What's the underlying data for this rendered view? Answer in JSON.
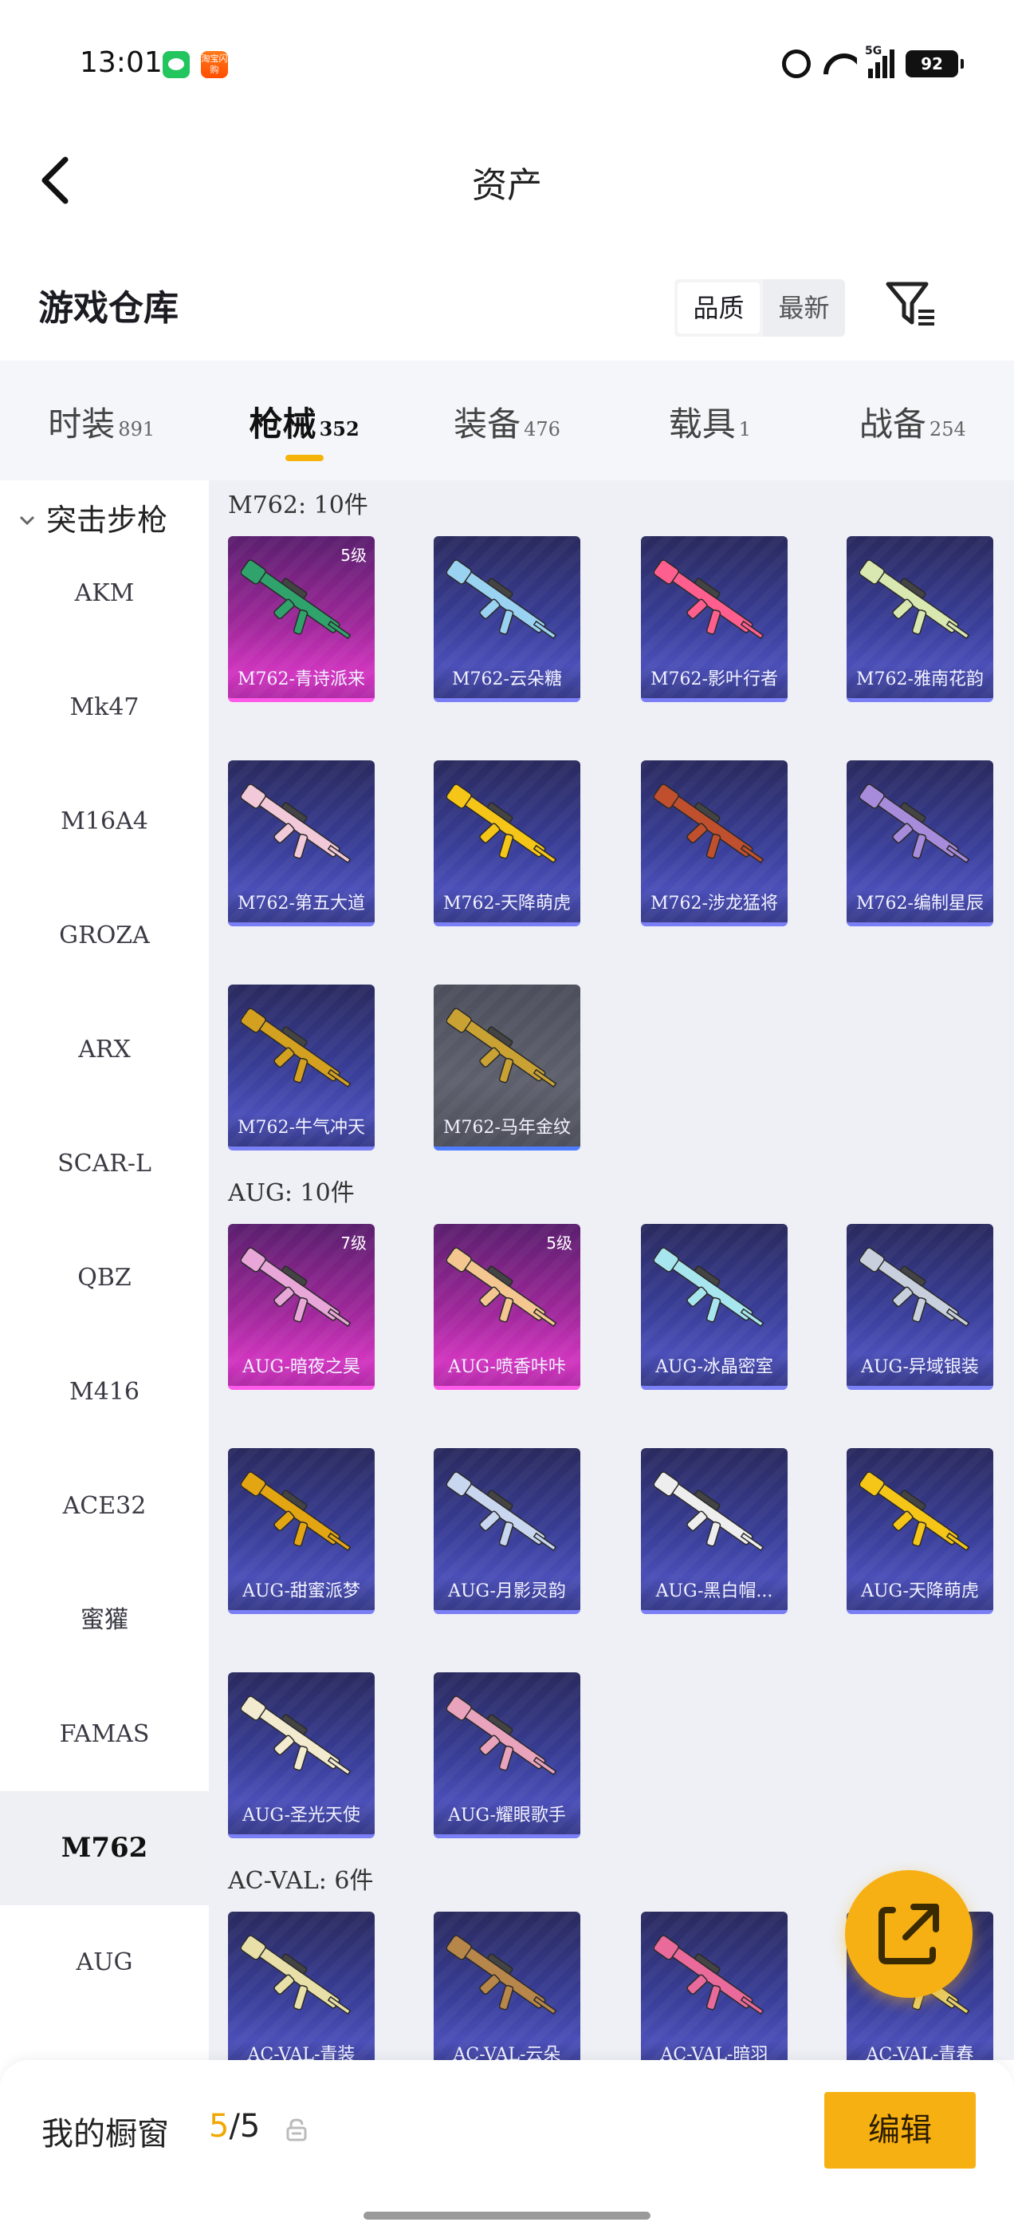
{
  "status_bar": {
    "time": "13:01",
    "network": "5G",
    "battery": "92",
    "taobao_label": "淘宝闪购"
  },
  "header": {
    "title": "资产"
  },
  "warehouse": {
    "title": "游戏仓库",
    "sort_options": [
      "品质",
      "最新"
    ],
    "active_sort": "品质"
  },
  "tabs": [
    {
      "label": "时装",
      "count": "891"
    },
    {
      "label": "枪械",
      "count": "352",
      "active": true
    },
    {
      "label": "装备",
      "count": "476"
    },
    {
      "label": "载具",
      "count": "1"
    },
    {
      "label": "战备",
      "count": "254"
    }
  ],
  "sidebar": {
    "category": "突击步枪",
    "items": [
      "AKM",
      "Mk47",
      "M16A4",
      "GROZA",
      "ARX",
      "SCAR-L",
      "QBZ",
      "M416",
      "ACE32",
      "蜜獾",
      "FAMAS",
      "M762",
      "AUG"
    ],
    "active": "M762"
  },
  "groups": [
    {
      "title": "M762: 10件",
      "items": [
        {
          "name": "M762-青诗派来",
          "level": "5级",
          "rarity": "pink",
          "color": "#2fa36b"
        },
        {
          "name": "M762-云朵糖",
          "level": "",
          "rarity": "purple",
          "color": "#9ad2f2"
        },
        {
          "name": "M762-影叶行者",
          "level": "",
          "rarity": "purple",
          "color": "#ff5f8f"
        },
        {
          "name": "M762-雅南花韵",
          "level": "",
          "rarity": "purple",
          "color": "#d9e8b0"
        },
        {
          "name": "M762-第五大道",
          "level": "",
          "rarity": "purple",
          "color": "#f2c9d8"
        },
        {
          "name": "M762-天降萌虎",
          "level": "",
          "rarity": "purple",
          "color": "#f5c518"
        },
        {
          "name": "M762-涉龙猛将",
          "level": "",
          "rarity": "purple",
          "color": "#c0502d"
        },
        {
          "name": "M762-编制星辰",
          "level": "",
          "rarity": "purple",
          "color": "#a88cdc"
        },
        {
          "name": "M762-牛气冲天",
          "level": "",
          "rarity": "purple",
          "color": "#d4a020"
        },
        {
          "name": "M762-马年金纹",
          "level": "",
          "rarity": "gray",
          "color": "#c9a233"
        }
      ]
    },
    {
      "title": "AUG: 10件",
      "items": [
        {
          "name": "AUG-暗夜之昊",
          "level": "7级",
          "rarity": "pink",
          "color": "#e8a7d8"
        },
        {
          "name": "AUG-喷香咔咔",
          "level": "5级",
          "rarity": "pink",
          "color": "#f3c78f"
        },
        {
          "name": "AUG-冰晶密室",
          "level": "",
          "rarity": "purple",
          "color": "#a8e6ef"
        },
        {
          "name": "AUG-异域银装",
          "level": "",
          "rarity": "purple",
          "color": "#c7d0dc"
        },
        {
          "name": "AUG-甜蜜派梦",
          "level": "",
          "rarity": "purple",
          "color": "#e3a512"
        },
        {
          "name": "AUG-月影灵韵",
          "level": "",
          "rarity": "purple",
          "color": "#c8d6ef"
        },
        {
          "name": "AUG-黑白帽...",
          "level": "",
          "rarity": "purple",
          "color": "#eeeeee"
        },
        {
          "name": "AUG-天降萌虎",
          "level": "",
          "rarity": "purple",
          "color": "#f5c518"
        },
        {
          "name": "AUG-圣光天使",
          "level": "",
          "rarity": "purple",
          "color": "#f2ebd0"
        },
        {
          "name": "AUG-耀眼歌手",
          "level": "",
          "rarity": "purple",
          "color": "#e9a3bd"
        }
      ]
    },
    {
      "title": "AC-VAL: 6件",
      "items": [
        {
          "name": "AC-VAL-青装",
          "level": "",
          "rarity": "purple",
          "color": "#e8e0a8"
        },
        {
          "name": "AC-VAL-云朵",
          "level": "",
          "rarity": "purple",
          "color": "#b7864a"
        },
        {
          "name": "AC-VAL-暗羽",
          "level": "",
          "rarity": "purple",
          "color": "#e96a9b"
        },
        {
          "name": "AC-VAL-青春",
          "level": "",
          "rarity": "purple",
          "color": "#e6d070"
        }
      ]
    }
  ],
  "showcase": {
    "label": "我的橱窗",
    "current": "5",
    "total": "/5"
  },
  "edit_button": "编辑",
  "colors": {
    "accent": "#f7b011",
    "tab_indicator": "#f6b40a"
  }
}
